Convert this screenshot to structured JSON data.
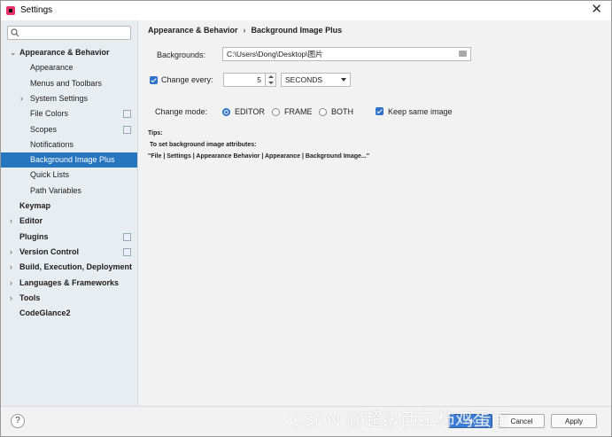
{
  "window": {
    "title": "Settings"
  },
  "search": {
    "placeholder": ""
  },
  "tree": [
    {
      "label": "Appearance & Behavior",
      "bold": true,
      "arrow": "⌄",
      "indent": 0
    },
    {
      "label": "Appearance",
      "indent": 1
    },
    {
      "label": "Menus and Toolbars",
      "indent": 1
    },
    {
      "label": "System Settings",
      "indent": 1,
      "arrow": "›"
    },
    {
      "label": "File Colors",
      "indent": 1,
      "badge": true
    },
    {
      "label": "Scopes",
      "indent": 1,
      "badge": true
    },
    {
      "label": "Notifications",
      "indent": 1
    },
    {
      "label": "Background Image Plus",
      "indent": 1,
      "selected": true
    },
    {
      "label": "Quick Lists",
      "indent": 1
    },
    {
      "label": "Path Variables",
      "indent": 1
    },
    {
      "label": "Keymap",
      "bold": true,
      "indent": 0
    },
    {
      "label": "Editor",
      "bold": true,
      "indent": 0,
      "arrow": "›"
    },
    {
      "label": "Plugins",
      "bold": true,
      "indent": 0,
      "badge": true
    },
    {
      "label": "Version Control",
      "bold": true,
      "indent": 0,
      "arrow": "›",
      "badge": true
    },
    {
      "label": "Build, Execution, Deployment",
      "bold": true,
      "indent": 0,
      "arrow": "›"
    },
    {
      "label": "Languages & Frameworks",
      "bold": true,
      "indent": 0,
      "arrow": "›"
    },
    {
      "label": "Tools",
      "bold": true,
      "indent": 0,
      "arrow": "›"
    },
    {
      "label": "CodeGlance2",
      "bold": true,
      "indent": 0
    }
  ],
  "breadcrumb": {
    "parent": "Appearance & Behavior",
    "sep": "›",
    "current": "Background Image Plus"
  },
  "backgrounds": {
    "label": "Backgrounds:",
    "value": "C:\\Users\\Dong\\Desktop\\图片"
  },
  "change_every": {
    "label": "Change every:",
    "checked": true,
    "value": "5",
    "unit": "SECONDS"
  },
  "change_mode": {
    "label": "Change mode:",
    "options": [
      "EDITOR",
      "FRAME",
      "BOTH"
    ],
    "selected": "EDITOR",
    "keep_same_label": "Keep same image",
    "keep_same_checked": true
  },
  "tips": {
    "title": "Tips:",
    "line1": "To set background image attributes:",
    "line2": "\"File | Settings | Appearance  Behavior | Appearance | Background Image...\""
  },
  "footer": {
    "help": "?",
    "ok": "OK",
    "cancel": "Cancel",
    "apply": "Apply"
  },
  "watermark": "CSDN @超级西红柿鸡蛋面",
  "colors": {
    "accent": "#2675bf",
    "checkbox": "#2e73c9"
  }
}
